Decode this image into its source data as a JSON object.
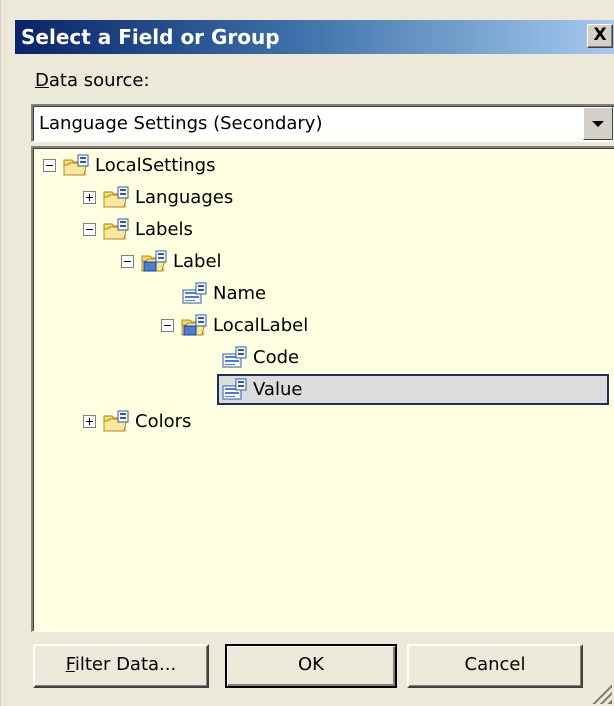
{
  "dialog": {
    "title": "Select a Field or Group",
    "close_label": "X"
  },
  "datasource": {
    "label_prefix": "D",
    "label_rest": "ata source:",
    "selected": "Language Settings (Secondary)"
  },
  "tree": {
    "nodes": [
      {
        "label": "LocalSettings",
        "icon": "group-folder-icon",
        "expander": "minus"
      },
      {
        "label": "Languages",
        "icon": "group-folder-icon",
        "expander": "plus"
      },
      {
        "label": "Labels",
        "icon": "group-folder-icon",
        "expander": "minus"
      },
      {
        "label": "Label",
        "icon": "repeating-group-icon",
        "expander": "minus"
      },
      {
        "label": "Name",
        "icon": "field-icon",
        "expander": "none"
      },
      {
        "label": "LocalLabel",
        "icon": "repeating-group-icon",
        "expander": "minus"
      },
      {
        "label": "Code",
        "icon": "field-icon",
        "expander": "none"
      },
      {
        "label": "Value",
        "icon": "field-icon",
        "expander": "none",
        "selected": true
      },
      {
        "label": "Colors",
        "icon": "group-folder-icon",
        "expander": "plus"
      }
    ]
  },
  "buttons": {
    "filter_prefix": "F",
    "filter_rest": "ilter Data...",
    "ok": "OK",
    "cancel": "Cancel"
  }
}
